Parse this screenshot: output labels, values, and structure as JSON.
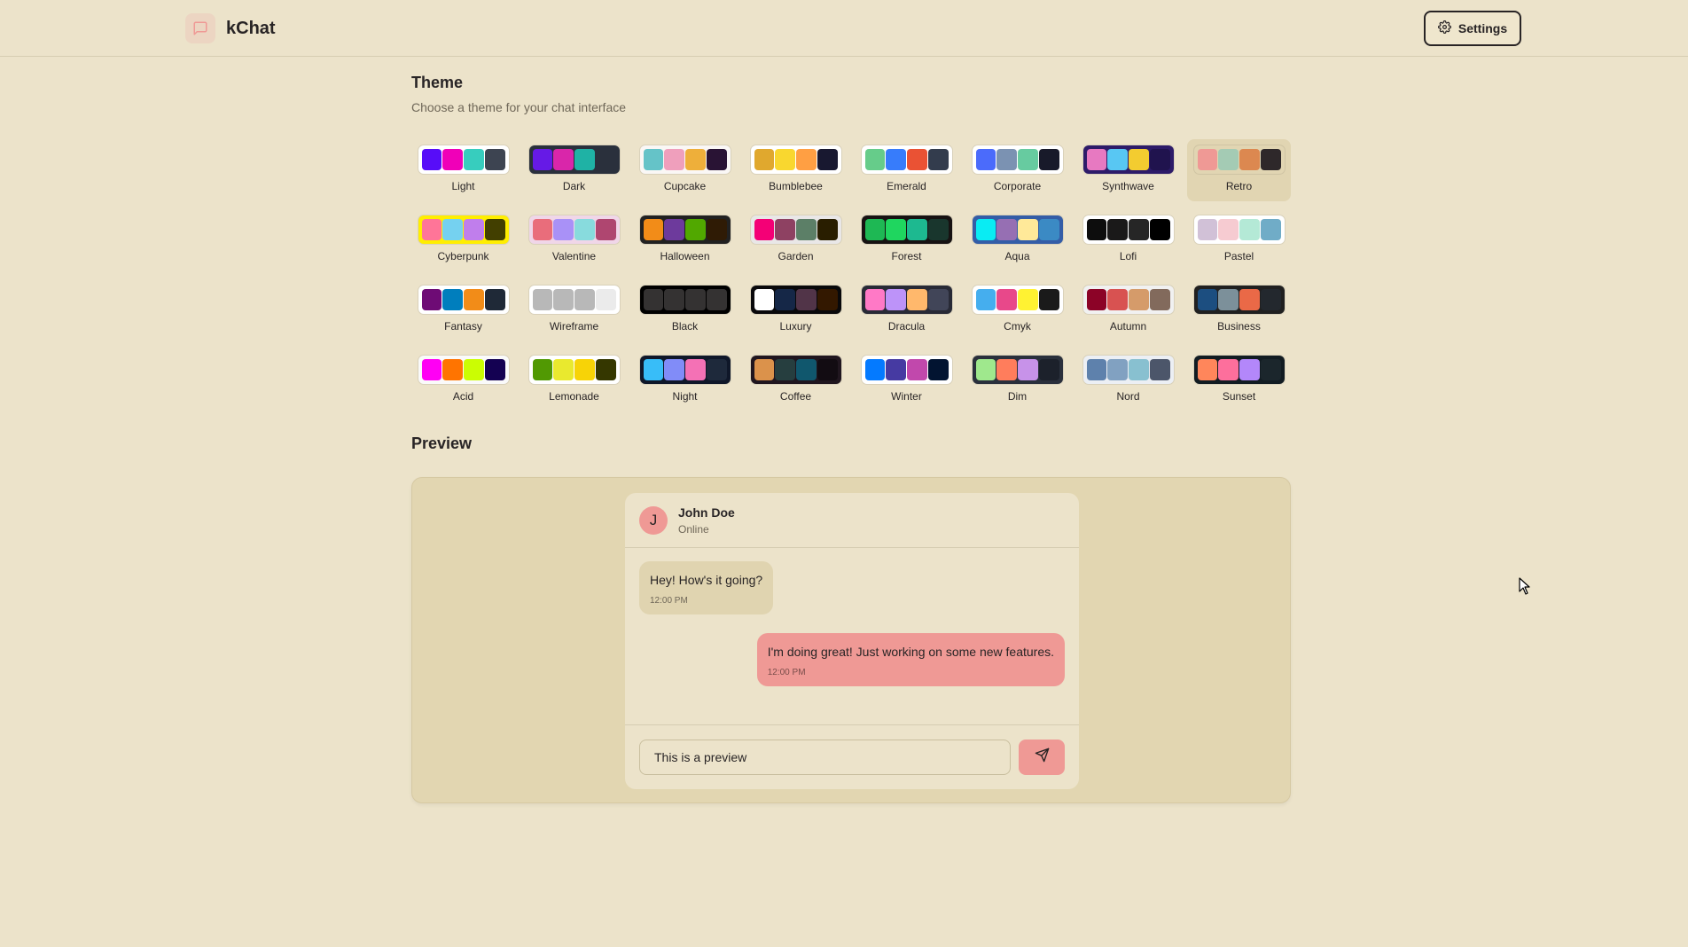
{
  "app": {
    "title": "kChat",
    "icon": "chat-bubble-icon"
  },
  "navbar": {
    "settings_label": "Settings",
    "settings_icon": "gear-icon"
  },
  "theme_section": {
    "title": "Theme",
    "subtitle": "Choose a theme for your chat interface",
    "selected": "Retro",
    "themes": [
      {
        "name": "Light",
        "bg": "#ffffff",
        "colors": [
          "#570df8",
          "#f000b8",
          "#37cdbe",
          "#3d4451"
        ]
      },
      {
        "name": "Dark",
        "bg": "#2a303c",
        "colors": [
          "#661ae6",
          "#d926aa",
          "#1fb2a5",
          "#2a303c"
        ]
      },
      {
        "name": "Cupcake",
        "bg": "#faf7f5",
        "colors": [
          "#65c3c8",
          "#ef9fbc",
          "#eeaf3a",
          "#291334"
        ]
      },
      {
        "name": "Bumblebee",
        "bg": "#ffffff",
        "colors": [
          "#e0a82e",
          "#f9d72f",
          "#ff9f43",
          "#181830"
        ]
      },
      {
        "name": "Emerald",
        "bg": "#ffffff",
        "colors": [
          "#66cc8a",
          "#377cfb",
          "#ea5234",
          "#333c4d"
        ]
      },
      {
        "name": "Corporate",
        "bg": "#ffffff",
        "colors": [
          "#4b6bfb",
          "#7b92b2",
          "#67cba0",
          "#181a2a"
        ]
      },
      {
        "name": "Synthwave",
        "bg": "#2d1b69",
        "colors": [
          "#e779c1",
          "#58c7f3",
          "#f3cc30",
          "#20134e"
        ]
      },
      {
        "name": "Retro",
        "bg": "#e1d5b2",
        "colors": [
          "#ef9995",
          "#a4cbb4",
          "#dc8850",
          "#2e282a"
        ]
      },
      {
        "name": "Cyberpunk",
        "bg": "#ffee00",
        "colors": [
          "#ff7598",
          "#75d1f0",
          "#c07eec",
          "#423f00"
        ]
      },
      {
        "name": "Valentine",
        "bg": "#f0d6e8",
        "colors": [
          "#e96d7b",
          "#a991f7",
          "#88dbdd",
          "#af4670"
        ]
      },
      {
        "name": "Halloween",
        "bg": "#212121",
        "colors": [
          "#f28c18",
          "#6d3a9c",
          "#51a800",
          "#2f1b05"
        ]
      },
      {
        "name": "Garden",
        "bg": "#e9e7e7",
        "colors": [
          "#f40076",
          "#8e4162",
          "#5c7f67",
          "#291e00"
        ]
      },
      {
        "name": "Forest",
        "bg": "#171212",
        "colors": [
          "#1eb854",
          "#1fd65f",
          "#1db990",
          "#19362d"
        ]
      },
      {
        "name": "Aqua",
        "bg": "#345da7",
        "colors": [
          "#09ecf3",
          "#966fb3",
          "#ffe999",
          "#3b8ac4"
        ]
      },
      {
        "name": "Lofi",
        "bg": "#ffffff",
        "colors": [
          "#0d0d0d",
          "#1a1919",
          "#262626",
          "#000000"
        ]
      },
      {
        "name": "Pastel",
        "bg": "#ffffff",
        "colors": [
          "#d1c1d7",
          "#f6cbd1",
          "#b4e9d6",
          "#70acc7"
        ]
      },
      {
        "name": "Fantasy",
        "bg": "#ffffff",
        "colors": [
          "#6e0b75",
          "#007ebd",
          "#f28c18",
          "#1f2937"
        ]
      },
      {
        "name": "Wireframe",
        "bg": "#ffffff",
        "colors": [
          "#b8b8b8",
          "#b8b8b8",
          "#b8b8b8",
          "#ebebeb"
        ]
      },
      {
        "name": "Black",
        "bg": "#000000",
        "colors": [
          "#343232",
          "#343232",
          "#343232",
          "#343232"
        ]
      },
      {
        "name": "Luxury",
        "bg": "#09090b",
        "colors": [
          "#ffffff",
          "#152747",
          "#513448",
          "#331800"
        ]
      },
      {
        "name": "Dracula",
        "bg": "#282a36",
        "colors": [
          "#ff79c6",
          "#bd93f9",
          "#ffb86c",
          "#414558"
        ]
      },
      {
        "name": "Cmyk",
        "bg": "#ffffff",
        "colors": [
          "#45aeee",
          "#e8488a",
          "#fff232",
          "#1a1a1a"
        ]
      },
      {
        "name": "Autumn",
        "bg": "#f1f1f1",
        "colors": [
          "#8c0327",
          "#d85251",
          "#d59b6a",
          "#826a5c"
        ]
      },
      {
        "name": "Business",
        "bg": "#202020",
        "colors": [
          "#1c4e80",
          "#7c909a",
          "#ea6947",
          "#23282e"
        ]
      },
      {
        "name": "Acid",
        "bg": "#fafafa",
        "colors": [
          "#ff00f4",
          "#ff7400",
          "#cbfd03",
          "#140152"
        ]
      },
      {
        "name": "Lemonade",
        "bg": "#ffffff",
        "colors": [
          "#519903",
          "#e9e92e",
          "#f7d307",
          "#353700"
        ]
      },
      {
        "name": "Night",
        "bg": "#0f1729",
        "colors": [
          "#38bdf8",
          "#818cf8",
          "#f471b5",
          "#1e293b"
        ]
      },
      {
        "name": "Coffee",
        "bg": "#20161f",
        "colors": [
          "#db924b",
          "#263e3f",
          "#10576d",
          "#120c12"
        ]
      },
      {
        "name": "Winter",
        "bg": "#ffffff",
        "colors": [
          "#047aff",
          "#463aa2",
          "#c148ac",
          "#021431"
        ]
      },
      {
        "name": "Dim",
        "bg": "#2a303c",
        "colors": [
          "#9fe88d",
          "#ff7d5c",
          "#c792e9",
          "#1c212b"
        ]
      },
      {
        "name": "Nord",
        "bg": "#eceff4",
        "colors": [
          "#5e81ac",
          "#81a1c1",
          "#88c0d0",
          "#4c566a"
        ]
      },
      {
        "name": "Sunset",
        "bg": "#121c22",
        "colors": [
          "#ff865b",
          "#fd6f9c",
          "#b387fa",
          "#1b262c"
        ]
      }
    ]
  },
  "preview_section": {
    "title": "Preview",
    "contact": {
      "initial": "J",
      "name": "John Doe",
      "status": "Online"
    },
    "messages": [
      {
        "text": "Hey! How's it going?",
        "time": "12:00 PM",
        "direction": "incoming"
      },
      {
        "text": "I'm doing great! Just working on some new features.",
        "time": "12:00 PM",
        "direction": "outgoing"
      }
    ],
    "input_value": "This is a preview",
    "send_icon": "send-icon"
  }
}
